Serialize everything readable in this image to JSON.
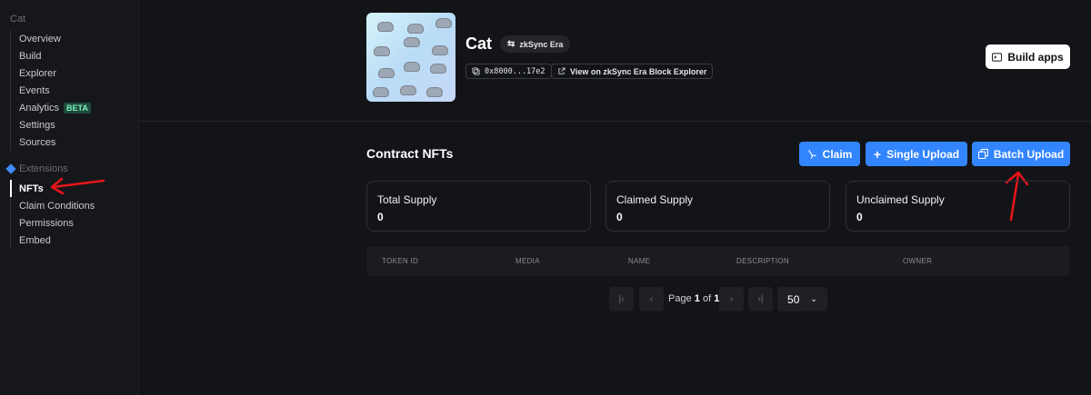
{
  "sidebar": {
    "heading": "Cat",
    "items": [
      {
        "label": "Overview"
      },
      {
        "label": "Build"
      },
      {
        "label": "Explorer"
      },
      {
        "label": "Events"
      },
      {
        "label": "Analytics",
        "badge": "BETA"
      },
      {
        "label": "Settings"
      },
      {
        "label": "Sources"
      }
    ],
    "extensions_heading": "Extensions",
    "extension_items": [
      {
        "label": "NFTs",
        "active": true
      },
      {
        "label": "Claim Conditions"
      },
      {
        "label": "Permissions"
      },
      {
        "label": "Embed"
      }
    ]
  },
  "header": {
    "title": "Cat",
    "chain": "zkSync Era",
    "address": "0x8000...17e2",
    "explorer_link": "View on zkSync Era Block Explorer",
    "build_apps": "Build apps"
  },
  "section": {
    "title": "Contract NFTs",
    "buttons": {
      "claim": "Claim",
      "single_upload": "Single Upload",
      "batch_upload": "Batch Upload"
    }
  },
  "stats": [
    {
      "label": "Total Supply",
      "value": "0"
    },
    {
      "label": "Claimed Supply",
      "value": "0"
    },
    {
      "label": "Unclaimed Supply",
      "value": "0"
    }
  ],
  "table": {
    "columns": [
      "TOKEN ID",
      "MEDIA",
      "NAME",
      "DESCRIPTION",
      "OWNER"
    ]
  },
  "pagination": {
    "page_word": "Page",
    "current": "1",
    "of_word": "of",
    "total": "1",
    "page_size": "50"
  },
  "colors": {
    "accent": "#3385ff",
    "annotation": "#e8151b",
    "background": "#131418"
  }
}
